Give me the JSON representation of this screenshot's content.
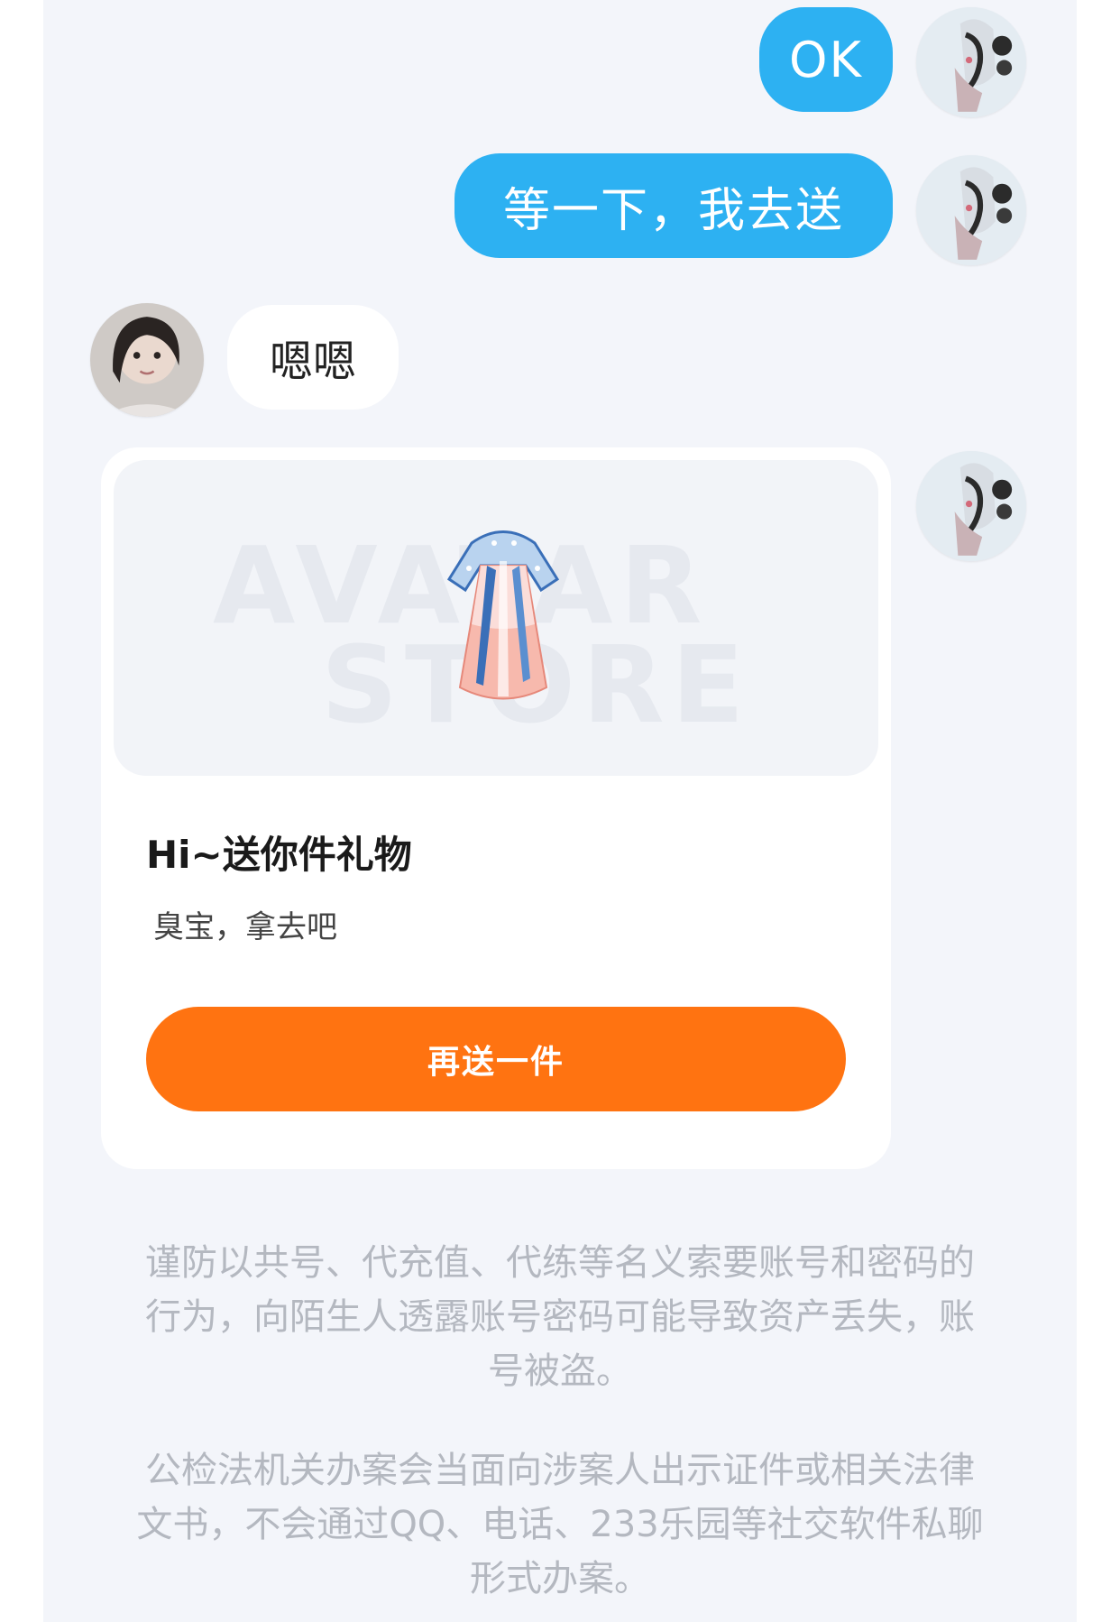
{
  "messages": {
    "mine_1": "OK",
    "mine_2": "等一下，我去送",
    "other_1": "嗯嗯"
  },
  "gift_card": {
    "watermark_line1": "AVATAR",
    "watermark_line2": "STORE",
    "title": "Hi~送你件礼物",
    "subtitle": "臭宝，拿去吧",
    "resend_button_label": "再送一件",
    "item_icon": "hanfu-dress-icon"
  },
  "notices": {
    "security_notice": "谨防以共号、代充值、代练等名义索要账号和密码的行为，向陌生人透露账号密码可能导致资产丢失，账号被盗。",
    "police_notice": "公检法机关办案会当面向涉案人出示证件或相关法律文书，不会通过QQ、电话、233乐园等社交软件私聊形式办案。"
  },
  "colors": {
    "my_bubble": "#2db1f2",
    "other_bubble": "#ffffff",
    "button": "#ff7311",
    "background": "#f3f5fa"
  }
}
